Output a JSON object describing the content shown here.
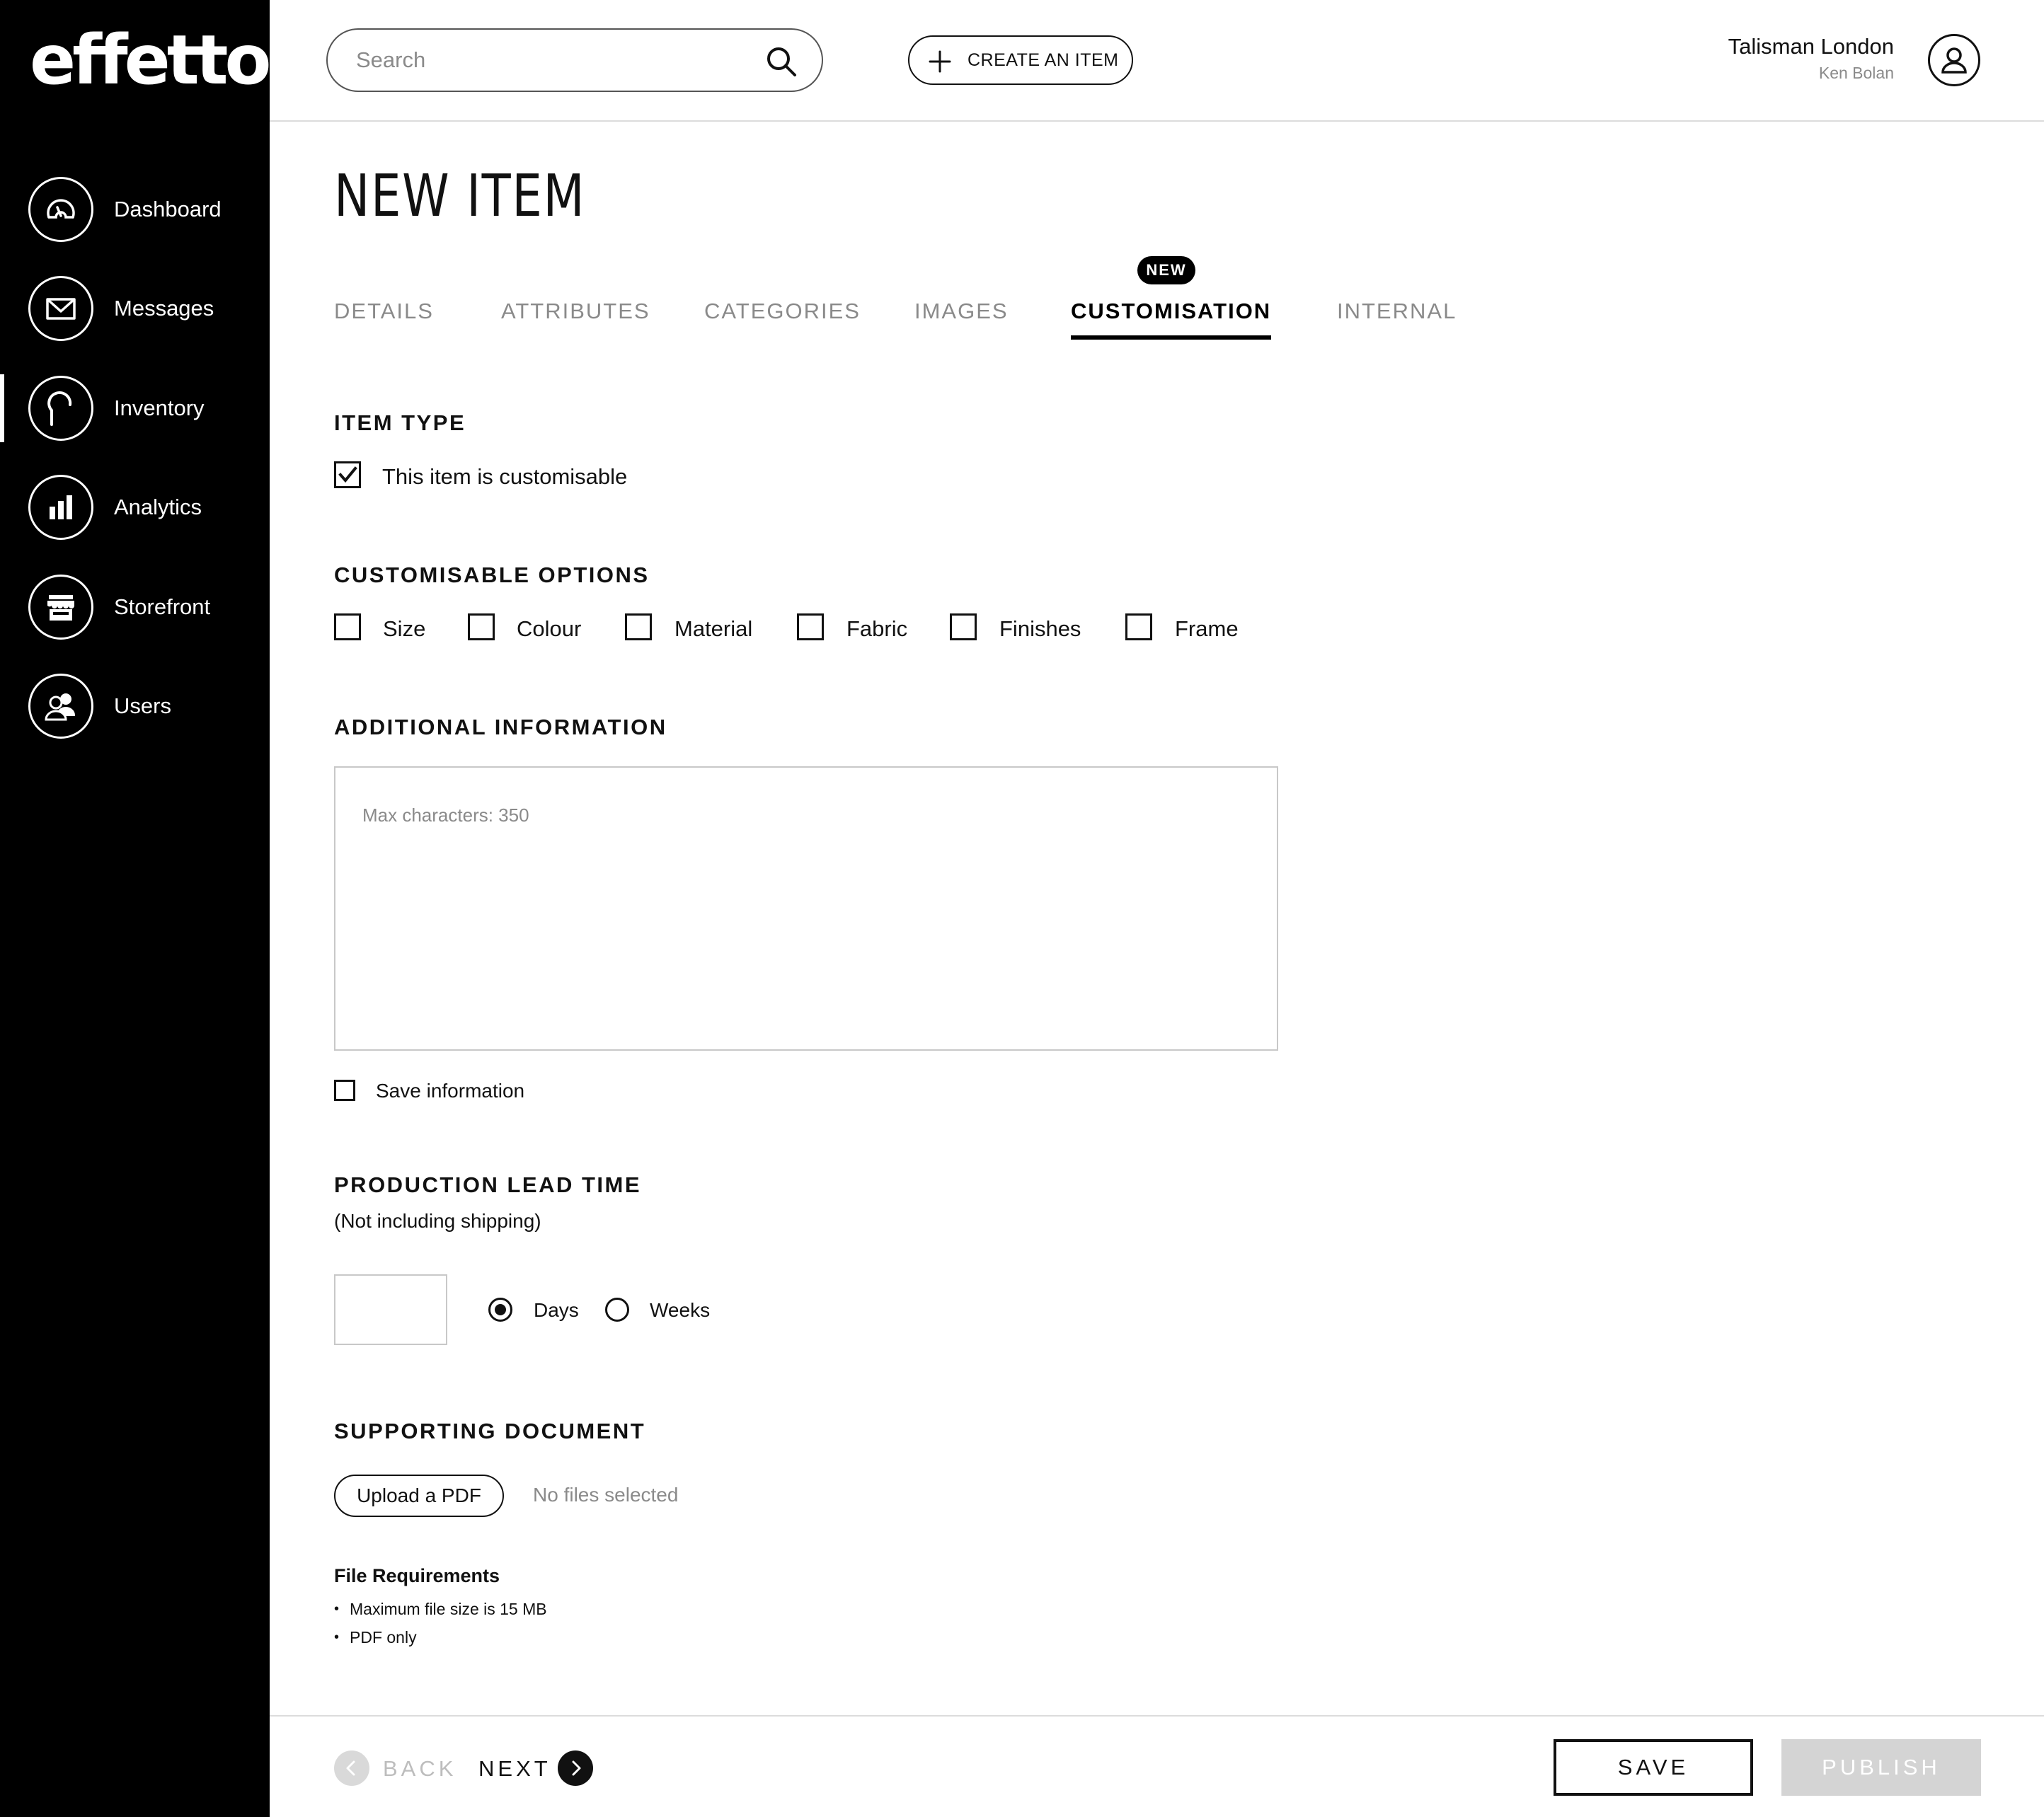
{
  "app": {
    "logo": "effetto"
  },
  "sidebar": {
    "items": [
      {
        "label": "Dashboard",
        "icon": "gauge-icon",
        "active": false
      },
      {
        "label": "Messages",
        "icon": "envelope-icon",
        "active": false
      },
      {
        "label": "Inventory",
        "icon": "hanger-icon",
        "active": true
      },
      {
        "label": "Analytics",
        "icon": "bar-chart-icon",
        "active": false
      },
      {
        "label": "Storefront",
        "icon": "store-icon",
        "active": false
      },
      {
        "label": "Users",
        "icon": "users-icon",
        "active": false
      }
    ]
  },
  "header": {
    "search_placeholder": "Search",
    "search_value": "",
    "create_label": "CREATE AN ITEM",
    "user_name": "Talisman London",
    "user_sub": "Ken Bolan"
  },
  "page": {
    "title": "NEW ITEM",
    "badge": "NEW",
    "tabs": [
      {
        "label": "DETAILS",
        "active": false
      },
      {
        "label": "ATTRIBUTES",
        "active": false
      },
      {
        "label": "CATEGORIES",
        "active": false
      },
      {
        "label": "IMAGES",
        "active": false
      },
      {
        "label": "CUSTOMISATION",
        "active": true
      },
      {
        "label": "INTERNAL",
        "active": false
      }
    ]
  },
  "item_type": {
    "title": "ITEM TYPE",
    "customisable_label": "This item is customisable",
    "customisable_checked": true
  },
  "options": {
    "title": "CUSTOMISABLE OPTIONS",
    "items": [
      {
        "label": "Size",
        "checked": false
      },
      {
        "label": "Colour",
        "checked": false
      },
      {
        "label": "Material",
        "checked": false
      },
      {
        "label": "Fabric",
        "checked": false
      },
      {
        "label": "Finishes",
        "checked": false
      },
      {
        "label": "Frame",
        "checked": false
      }
    ]
  },
  "additional": {
    "title": "ADDITIONAL INFORMATION",
    "placeholder": "Max characters: 350",
    "value": "",
    "save_label": "Save information",
    "save_checked": false
  },
  "lead_time": {
    "title": "PRODUCTION LEAD TIME",
    "subtitle": "(Not including shipping)",
    "value": "",
    "units": [
      {
        "label": "Days",
        "selected": true
      },
      {
        "label": "Weeks",
        "selected": false
      }
    ]
  },
  "document": {
    "title": "SUPPORTING DOCUMENT",
    "upload_label": "Upload a PDF",
    "status": "No files selected",
    "requirements_title": "File Requirements",
    "requirements": [
      "Maximum file size is 15 MB",
      "PDF only"
    ]
  },
  "footer": {
    "back_label": "BACK",
    "next_label": "NEXT",
    "save_label": "SAVE",
    "publish_label": "PUBLISH"
  },
  "colors": {
    "sidebar_bg": "#000000",
    "text": "#111111",
    "muted": "#8a8a8a",
    "disabled_bg": "#d4d4d4",
    "border": "#c8c8c8"
  }
}
